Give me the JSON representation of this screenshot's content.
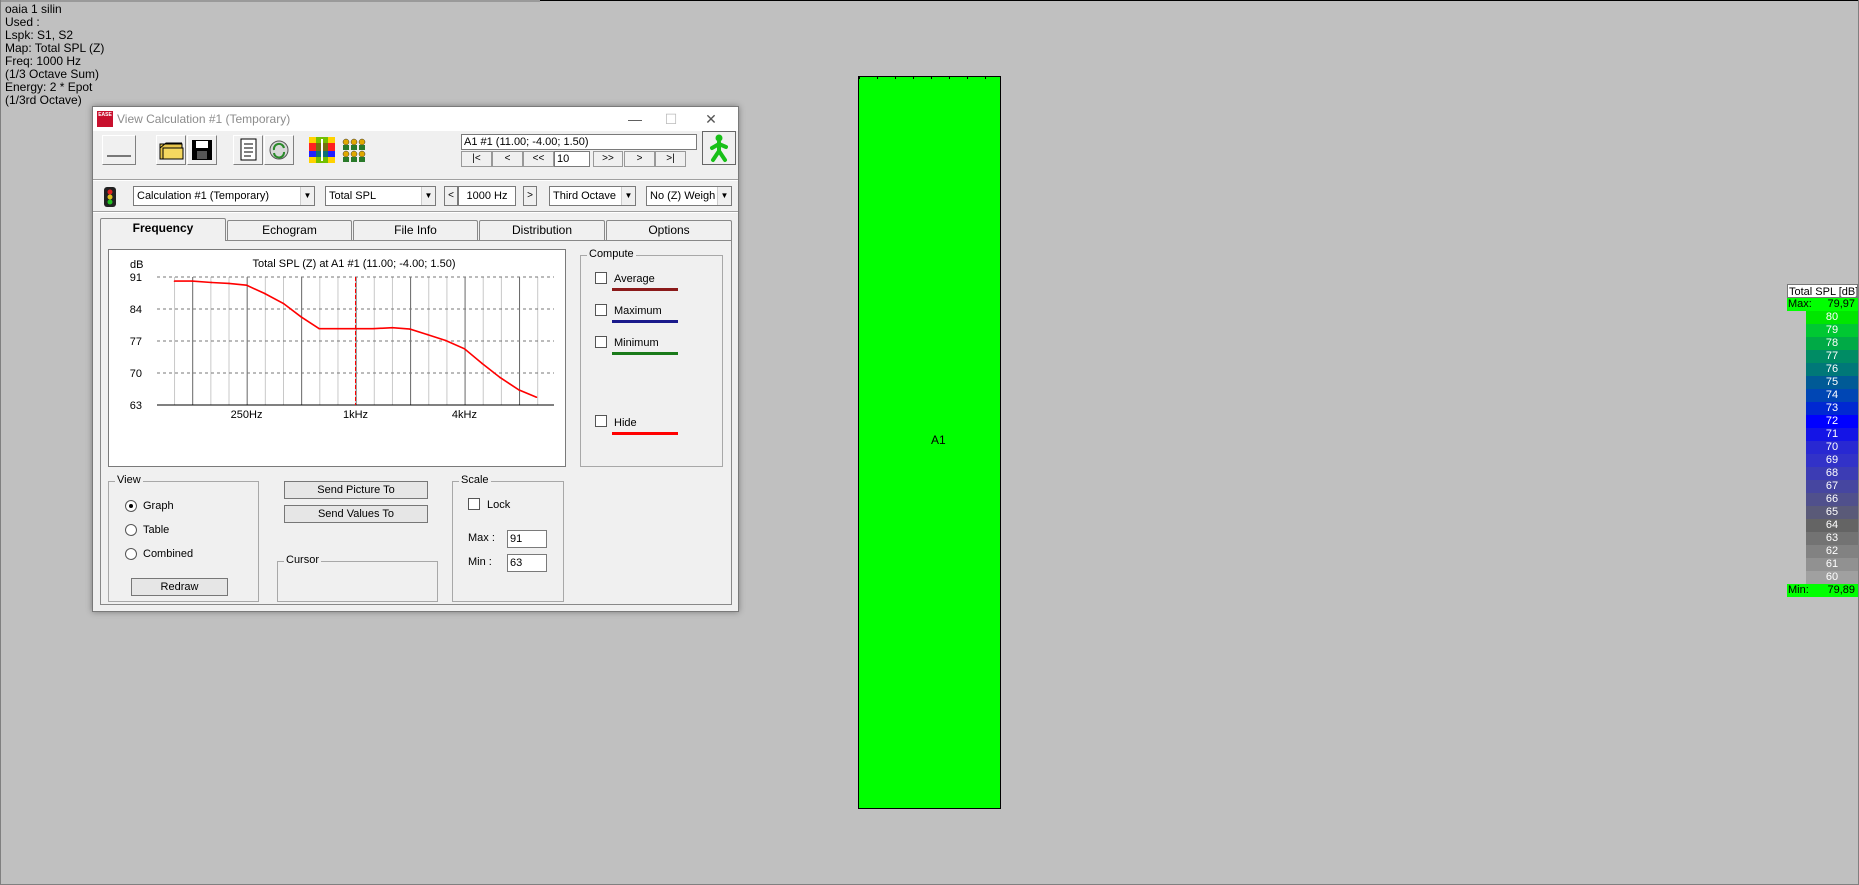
{
  "info_lines": [
    "oaia 1 silin",
    "Used :",
    "Lspk: S1, S2",
    "Map: Total SPL (Z)",
    "Freq: 1000 Hz",
    "(1/3 Octave Sum)",
    "Energy: 2 * Epot",
    "(1/3rd Octave)"
  ],
  "surface": {
    "label": "A1",
    "color": "#00ff00"
  },
  "legend": {
    "title": "Total SPL [dB]",
    "max_label": "Max:",
    "max_value": "79,97",
    "min_label": "Min:",
    "min_value": "79,89",
    "rows": [
      {
        "value": "80",
        "color": "#00e600"
      },
      {
        "value": "79",
        "color": "#00c832"
      },
      {
        "value": "78",
        "color": "#00aa46"
      },
      {
        "value": "77",
        "color": "#008c64"
      },
      {
        "value": "76",
        "color": "#007878"
      },
      {
        "value": "75",
        "color": "#005a96"
      },
      {
        "value": "74",
        "color": "#0046b4"
      },
      {
        "value": "73",
        "color": "#0028d2"
      },
      {
        "value": "72",
        "color": "#0000ff"
      },
      {
        "value": "71",
        "color": "#1414e6"
      },
      {
        "value": "70",
        "color": "#2828d2"
      },
      {
        "value": "69",
        "color": "#3232c8"
      },
      {
        "value": "68",
        "color": "#3c3cb4"
      },
      {
        "value": "67",
        "color": "#4646a0"
      },
      {
        "value": "66",
        "color": "#50508c"
      },
      {
        "value": "65",
        "color": "#5a5a78"
      },
      {
        "value": "64",
        "color": "#646464"
      },
      {
        "value": "63",
        "color": "#737373"
      },
      {
        "value": "62",
        "color": "#828282"
      },
      {
        "value": "61",
        "color": "#919191"
      },
      {
        "value": "60",
        "color": "#a0a0a0"
      }
    ]
  },
  "window": {
    "title": "View Calculation #1 (Temporary)",
    "app_icon_text": "EASE",
    "controls": {
      "minimize": "—",
      "maximize": "☐",
      "close": "✕"
    },
    "toolbar": {
      "tools": [
        "line-tool-icon",
        "open-folder-icon",
        "save-disk-icon",
        "document-icon",
        "recycle-icon",
        "mapping-icon",
        "audience-icon"
      ]
    },
    "position_text": "A1 #1  (11.00; -4.00; 1.50)",
    "nav": {
      "first": "|<",
      "prev": "<",
      "prev_fast": "<<",
      "step": "10",
      "next_fast": ">>",
      "next": ">",
      "last": ">|"
    },
    "selectors": {
      "calculation": "Calculation #1 (Temporary)",
      "map": "Total SPL",
      "freq": "1000 Hz",
      "freq_prev": "<",
      "freq_next": ">",
      "band": "Third Octave",
      "weighting": "No (Z) Weigh"
    },
    "tabs": [
      "Frequency",
      "Echogram",
      "File Info",
      "Distribution",
      "Options"
    ],
    "active_tab": "Frequency",
    "compute": {
      "label": "Compute",
      "items": [
        {
          "label": "Average",
          "color": "#8b1a1a",
          "checked": false
        },
        {
          "label": "Maximum",
          "color": "#1a1a8b",
          "checked": false
        },
        {
          "label": "Minimum",
          "color": "#1a7a1a",
          "checked": false
        },
        {
          "label": "Hide",
          "color": "#ff0000",
          "checked": false
        }
      ]
    },
    "view": {
      "label": "View",
      "options": [
        "Graph",
        "Table",
        "Combined"
      ],
      "selected": "Graph",
      "redraw": "Redraw"
    },
    "send_picture": "Send Picture To",
    "send_values": "Send Values To",
    "cursor_label": "Cursor",
    "scale": {
      "label": "Scale",
      "lock": "Lock",
      "max_label": "Max :",
      "max": "91",
      "min_label": "Min :",
      "min": "63"
    }
  },
  "chart_data": {
    "type": "line",
    "title": "Total SPL (Z) at A1 #1  (11.00; -4.00; 1.50)",
    "ylabel": "dB",
    "ylim": [
      63,
      91
    ],
    "yticks": [
      91,
      84,
      77,
      70,
      63
    ],
    "xscale": "log",
    "xlim_hz": [
      80,
      12500
    ],
    "xtick_labels": [
      "250Hz",
      "1kHz",
      "4kHz"
    ],
    "xtick_hz": [
      250,
      1000,
      4000
    ],
    "cursor_hz": 1000,
    "line_color": "#ff0000",
    "series": [
      {
        "x_hz": [
          100,
          125,
          160,
          200,
          250,
          315,
          400,
          500,
          630,
          800,
          1000,
          1250,
          1600,
          2000,
          2500,
          3150,
          4000,
          5000,
          6300,
          8000,
          10000
        ],
        "values": [
          90.1,
          90.1,
          89.8,
          89.6,
          89.2,
          87.4,
          85.2,
          82.3,
          79.7,
          79.7,
          79.7,
          79.7,
          79.9,
          79.6,
          78.4,
          77.1,
          75.3,
          72.1,
          69.0,
          66.3,
          64.7
        ]
      }
    ]
  }
}
